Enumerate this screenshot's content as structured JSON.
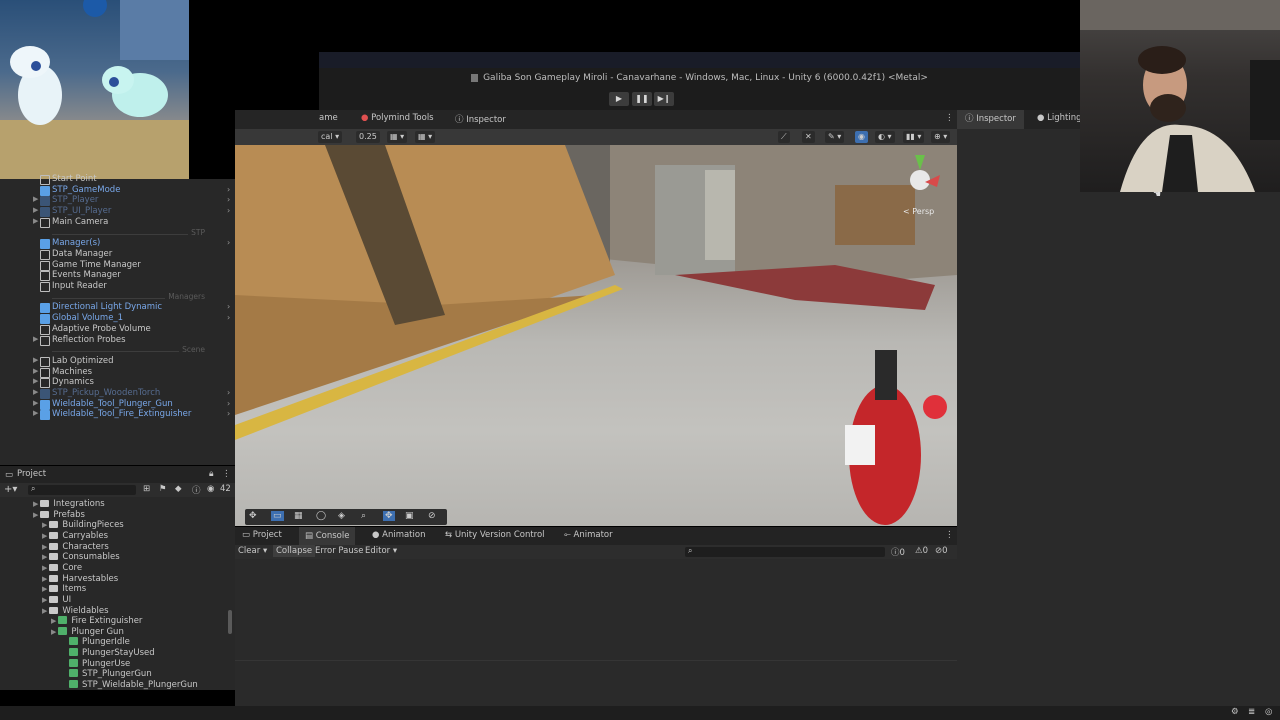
{
  "window": {
    "title": "Galiba Son Gameplay Miroli - Canavarhane - Windows, Mac, Linux - Unity 6 (6000.0.42f1) <Metal>",
    "play_icon": "play-icon",
    "pause_icon": "pause-icon",
    "step_icon": "step-icon"
  },
  "center_tabs": [
    "ame",
    "Polymind Tools",
    "Inspector"
  ],
  "scene_toolbar": {
    "shading": "cal",
    "scale": "0.25",
    "persp_label": "< Persp"
  },
  "right_tabs": [
    "Inspector",
    "Lighting"
  ],
  "hierarchy": {
    "items": [
      {
        "label": "Start Point",
        "style": "normal",
        "expand": false,
        "more": false
      },
      {
        "label": "STP_GameMode",
        "style": "blue",
        "expand": false,
        "more": true
      },
      {
        "label": "STP_Player",
        "style": "dim",
        "expand": true,
        "more": true
      },
      {
        "label": "STP_UI_Player",
        "style": "dim",
        "expand": true,
        "more": true
      },
      {
        "label": "Main Camera",
        "style": "normal",
        "expand": true,
        "more": false
      },
      {
        "separator": "STP"
      },
      {
        "label": "Manager(s)",
        "style": "blue",
        "expand": false,
        "more": true
      },
      {
        "label": "Data Manager",
        "style": "normal",
        "expand": false,
        "more": false
      },
      {
        "label": "Game Time Manager",
        "style": "normal",
        "expand": false,
        "more": false
      },
      {
        "label": "Events Manager",
        "style": "normal",
        "expand": false,
        "more": false
      },
      {
        "label": "Input Reader",
        "style": "normal",
        "expand": false,
        "more": false
      },
      {
        "separator": "Managers"
      },
      {
        "label": "Directional Light Dynamic",
        "style": "blue",
        "expand": false,
        "more": true
      },
      {
        "label": "Global Volume_1",
        "style": "blue",
        "expand": false,
        "more": true
      },
      {
        "label": "Adaptive Probe Volume",
        "style": "normal",
        "expand": false,
        "more": false
      },
      {
        "label": "Reflection Probes",
        "style": "normal",
        "expand": true,
        "more": false
      },
      {
        "separator": "Scene"
      },
      {
        "label": "Lab Optimized",
        "style": "normal",
        "expand": true,
        "more": false
      },
      {
        "label": "Machines",
        "style": "normal",
        "expand": true,
        "more": false
      },
      {
        "label": "Dynamics",
        "style": "normal",
        "expand": true,
        "more": false
      },
      {
        "label": "STP_Pickup_WoodenTorch",
        "style": "dim",
        "expand": true,
        "more": true
      },
      {
        "label": "Wieldable_Tool_Plunger_Gun",
        "style": "blue",
        "expand": true,
        "more": true
      },
      {
        "label": "Wieldable_Tool_Fire_Extinguisher",
        "style": "blue",
        "expand": true,
        "more": true
      }
    ]
  },
  "project": {
    "tab": "Project",
    "count": "42",
    "tree": [
      {
        "label": "Integrations",
        "level": 0,
        "kind": "folder"
      },
      {
        "label": "Prefabs",
        "level": 0,
        "kind": "folder"
      },
      {
        "label": "BuildingPieces",
        "level": 1,
        "kind": "folder"
      },
      {
        "label": "Carryables",
        "level": 1,
        "kind": "folder"
      },
      {
        "label": "Characters",
        "level": 1,
        "kind": "folder"
      },
      {
        "label": "Consumables",
        "level": 1,
        "kind": "folder"
      },
      {
        "label": "Core",
        "level": 1,
        "kind": "folder"
      },
      {
        "label": "Harvestables",
        "level": 1,
        "kind": "folder"
      },
      {
        "label": "Items",
        "level": 1,
        "kind": "folder"
      },
      {
        "label": "UI",
        "level": 1,
        "kind": "folder"
      },
      {
        "label": "Wieldables",
        "level": 1,
        "kind": "folder"
      },
      {
        "label": "Fire Extinguisher",
        "level": 2,
        "kind": "prefab"
      },
      {
        "label": "Plunger Gun",
        "level": 2,
        "kind": "prefab"
      },
      {
        "label": "PlungerIdle",
        "level": 3,
        "kind": "prefab"
      },
      {
        "label": "PlungerStayUsed",
        "level": 3,
        "kind": "prefab"
      },
      {
        "label": "PlungerUse",
        "level": 3,
        "kind": "prefab"
      },
      {
        "label": "STP_PlungerGun",
        "level": 3,
        "kind": "prefab"
      },
      {
        "label": "STP_Wieldable_PlungerGun",
        "level": 3,
        "kind": "prefab"
      }
    ]
  },
  "console": {
    "tabs": [
      "Project",
      "Console",
      "Animation",
      "Unity Version Control",
      "Animator"
    ],
    "clear": "Clear",
    "collapse": "Collapse",
    "error_pause": "Error Pause",
    "editor": "Editor",
    "count_info": "0",
    "count_warn": "0",
    "count_error": "0"
  },
  "colors": {
    "accent_blue": "#79a8ea",
    "panel": "#282828",
    "toolbar": "#383838"
  }
}
